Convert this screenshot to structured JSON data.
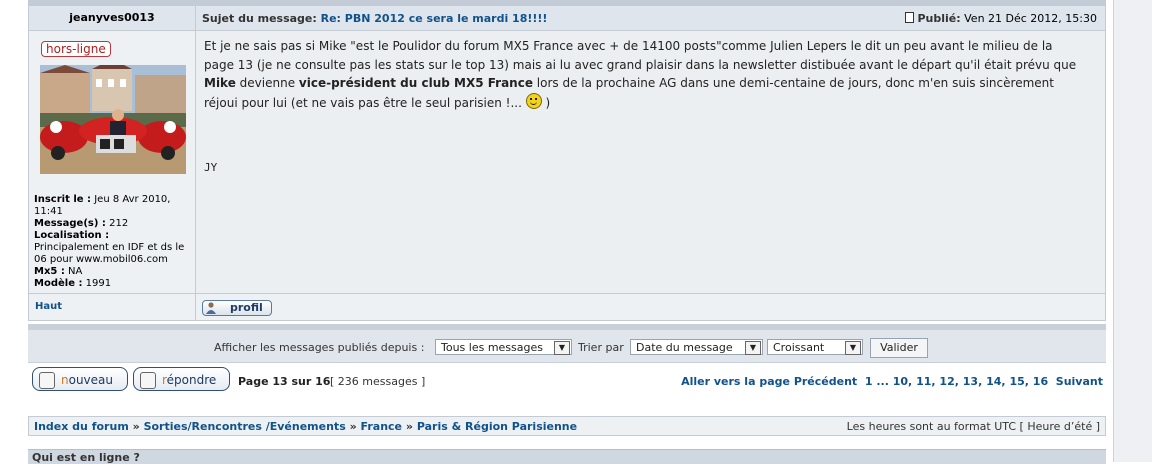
{
  "post": {
    "author": "jeanyves0013",
    "subject_label": "Sujet du message:",
    "subject": "Re: PBN 2012 ce sera le mardi 18!!!!",
    "published_label": "Publié:",
    "published_date": "Ven 21 Déc 2012, 15:30",
    "status": "hors-ligne",
    "profile": {
      "inscrit_label": "Inscrit le :",
      "inscrit": "Jeu 8 Avr 2010, 11:41",
      "messages_label": "Message(s) :",
      "messages": "212",
      "localisation_label": "Localisation :",
      "localisation": "Principalement en IDF et ds le 06 pour www.mobil06.com",
      "mx5_label": "Mx5 :",
      "mx5": "NA",
      "modele_label": "Modèle :",
      "modele": "1991"
    },
    "body": {
      "p1": "Et je ne sais pas si Mike \"est le Poulidor du forum MX5 France avec + de 14100 posts\"comme Julien Lepers le dit un peu avant le milieu de la page 13 (je ne consulte pas les stats sur le top 13) mais ai lu avec grand plaisir dans la newsletter distibuée avant le départ qu'il était prévu que ",
      "b1": "Mike",
      "p2": " devienne ",
      "b2": "vice-président du club MX5 France",
      "p3": " lors de la prochaine AG dans une demi-centaine de jours, donc m'en suis sincèrement réjoui pour lui (et ne vais pas être le seul parisien !... ",
      "p4": " )",
      "signature": "JY"
    },
    "haut": "Haut",
    "profil_button": "profil"
  },
  "filter": {
    "label_depuis": "Afficher les messages publiés depuis :",
    "depuis_value": "Tous les messages",
    "label_trier": "Trier par",
    "trier_value": "Date du message",
    "ordre_value": "Croissant",
    "valider": "Valider"
  },
  "actions": {
    "nouveau_first": "n",
    "nouveau_rest": "ouveau",
    "repondre_first": "r",
    "repondre_rest": "épondre",
    "page_info": "Page 13 sur 16",
    "message_count": "[ 236 messages ]",
    "goto_label": "Aller vers la page",
    "prev": "Précédent",
    "pages": [
      "1",
      "...",
      "10,",
      "11,",
      "12,",
      "13,",
      "14,",
      "15,",
      "16"
    ],
    "next": "Suivant"
  },
  "breadcrumb": {
    "items": [
      "Index du forum",
      "Sorties/Rencontres /Evénements",
      "France",
      "Paris & Région Parisienne"
    ],
    "separator": "»",
    "timezone": "Les heures sont au format UTC [ Heure d’été ]"
  },
  "who_online": "Qui est en ligne ?",
  "colors": {
    "link": "#105289",
    "accent_orange": "#d0781a",
    "status_red": "#b01d1d"
  }
}
